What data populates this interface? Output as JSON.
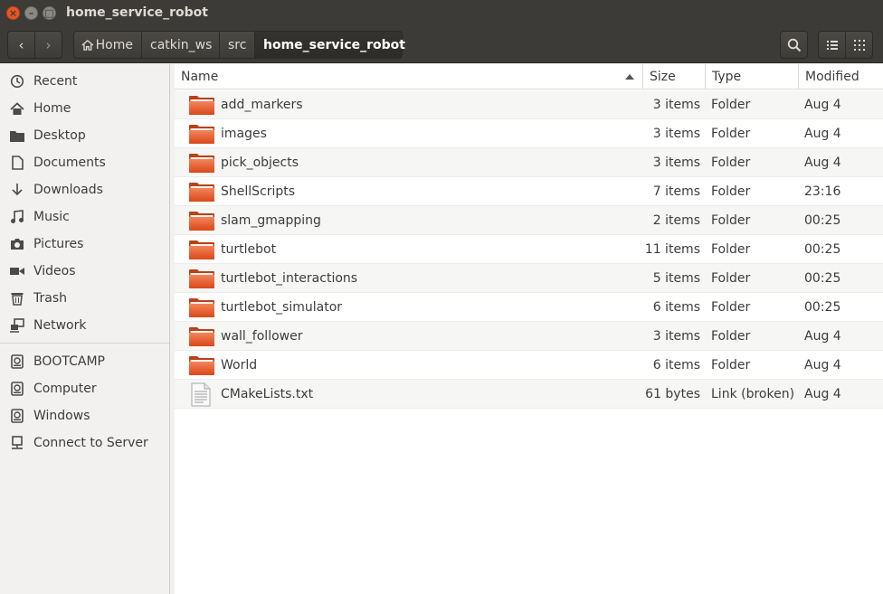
{
  "window": {
    "title": "home_service_robot",
    "controls": {
      "close": "×",
      "minimize": "–",
      "maximize": "□"
    }
  },
  "breadcrumb": [
    "Home",
    "catkin_ws",
    "src",
    "home_service_robot"
  ],
  "toolbar": {
    "back": "‹",
    "forward": "›"
  },
  "sidebar": {
    "places": [
      {
        "label": "Recent",
        "icon": "clock-icon"
      },
      {
        "label": "Home",
        "icon": "home-icon"
      },
      {
        "label": "Desktop",
        "icon": "folder-icon"
      },
      {
        "label": "Documents",
        "icon": "document-icon"
      },
      {
        "label": "Downloads",
        "icon": "download-icon"
      },
      {
        "label": "Music",
        "icon": "music-icon"
      },
      {
        "label": "Pictures",
        "icon": "camera-icon"
      },
      {
        "label": "Videos",
        "icon": "video-icon"
      },
      {
        "label": "Trash",
        "icon": "trash-icon"
      },
      {
        "label": "Network",
        "icon": "network-icon"
      }
    ],
    "devices": [
      {
        "label": "BOOTCAMP",
        "icon": "drive-icon"
      },
      {
        "label": "Computer",
        "icon": "drive-icon"
      },
      {
        "label": "Windows",
        "icon": "drive-icon"
      },
      {
        "label": "Connect to Server",
        "icon": "server-icon"
      }
    ]
  },
  "columns": {
    "name": "Name",
    "size": "Size",
    "type": "Type",
    "modified": "Modified"
  },
  "files": [
    {
      "name": "add_markers",
      "size": "3 items",
      "type": "Folder",
      "modified": "Aug 4",
      "kind": "folder"
    },
    {
      "name": "images",
      "size": "3 items",
      "type": "Folder",
      "modified": "Aug 4",
      "kind": "folder"
    },
    {
      "name": "pick_objects",
      "size": "3 items",
      "type": "Folder",
      "modified": "Aug 4",
      "kind": "folder"
    },
    {
      "name": "ShellScripts",
      "size": "7 items",
      "type": "Folder",
      "modified": "23:16",
      "kind": "folder"
    },
    {
      "name": "slam_gmapping",
      "size": "2 items",
      "type": "Folder",
      "modified": "00:25",
      "kind": "folder"
    },
    {
      "name": "turtlebot",
      "size": "11 items",
      "type": "Folder",
      "modified": "00:25",
      "kind": "folder"
    },
    {
      "name": "turtlebot_interactions",
      "size": "5 items",
      "type": "Folder",
      "modified": "00:25",
      "kind": "folder"
    },
    {
      "name": "turtlebot_simulator",
      "size": "6 items",
      "type": "Folder",
      "modified": "00:25",
      "kind": "folder"
    },
    {
      "name": "wall_follower",
      "size": "3 items",
      "type": "Folder",
      "modified": "Aug 4",
      "kind": "folder"
    },
    {
      "name": "World",
      "size": "6 items",
      "type": "Folder",
      "modified": "Aug 4",
      "kind": "folder"
    },
    {
      "name": "CMakeLists.txt",
      "size": "61 bytes",
      "type": "Link (broken)",
      "modified": "Aug 4",
      "kind": "file"
    }
  ],
  "colors": {
    "accent": "#e95420",
    "titlebar": "#3c3b37",
    "sidebar": "#f2f1f0"
  }
}
